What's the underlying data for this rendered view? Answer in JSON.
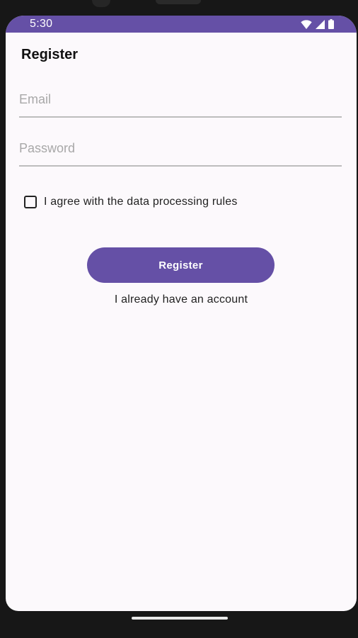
{
  "status_bar": {
    "time": "5:30",
    "icons": [
      "wifi-icon",
      "cellular-signal-icon",
      "battery-icon"
    ]
  },
  "page": {
    "title": "Register"
  },
  "form": {
    "email": {
      "value": "",
      "placeholder": "Email"
    },
    "password": {
      "value": "",
      "placeholder": "Password"
    },
    "agree_checkbox": {
      "label": "I agree with the data processing rules",
      "checked": false
    },
    "register_button_label": "Register",
    "login_link_text": "I already have an account"
  },
  "colors": {
    "accent": "#6550a6",
    "background": "#fcf9fc",
    "text": "#222222",
    "placeholder": "#a8a8a8",
    "field_underline": "#bdbdbd"
  }
}
